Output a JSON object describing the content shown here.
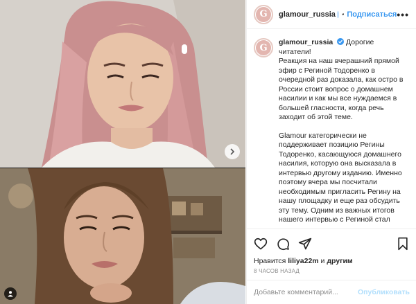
{
  "post": {
    "username": "glamour_russia",
    "separator": "•",
    "follow_label": "Подписаться",
    "more_label": "•••",
    "avatar_letter": "G"
  },
  "caption": {
    "username": "glamour_russia",
    "intro": "Дорогие читатели!",
    "paragraph1": "Реакция на наш вчерашний прямой эфир с Региной Тодоренко в очередной раз доказала, как остро в России стоит вопрос о домашнем насилии и как мы все нуждаемся в большей гласности, когда речь заходит об этой теме.",
    "paragraph2": "Glamour категорически не поддерживает позицию Регины Тодоренко, касающуюся домашнего насилия, которую она высказала в интервью другому изданию. Именно поэтому вчера мы посчитали необходимым пригласить Регину на нашу площадку и еще раз обсудить эту тему. Одним из важных итогов нашего интервью с Региной стал"
  },
  "actions": {
    "likes_prefix": "Нравится ",
    "likes_user": "liliya22m",
    "likes_suffix": " и ",
    "likes_others": "другим",
    "time_ago": "8 ЧАСОВ НАЗАД"
  },
  "comment": {
    "placeholder": "Добавьте комментарий...",
    "publish_label": "Опубликовать"
  },
  "colors": {
    "accent": "#3897f0",
    "publish_disabled": "#b2dffc"
  },
  "icons": {
    "like": "heart-icon",
    "comment": "comment-icon",
    "share": "share-icon",
    "save": "bookmark-icon",
    "next": "chevron-right-icon",
    "tagged": "person-tag-icon"
  }
}
